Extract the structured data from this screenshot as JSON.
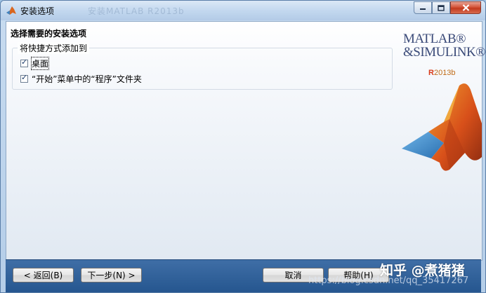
{
  "window": {
    "title": "安装选项",
    "ghost_title": "安装MATLAB R2013b"
  },
  "main": {
    "heading": "选择需要的安装选项",
    "group_label": "将快捷方式添加到",
    "options": [
      {
        "label": "桌面",
        "checked": true
      },
      {
        "label": "“开始”菜单中的“程序”文件夹",
        "checked": true
      }
    ]
  },
  "branding": {
    "product_line1": "MATLAB®",
    "product_line2": "&SIMULINK®",
    "release_prefix": "R",
    "release_suffix": "2013b"
  },
  "footer": {
    "back": "< 返回(B)",
    "next": "下一步(N) >",
    "cancel": "取消",
    "help": "帮助(H)"
  },
  "overlay": {
    "watermark": "知乎 @煮猪猪",
    "url": "https://blog.csdn.net/qq_35417267"
  },
  "colors": {
    "footer": "#2c5c96",
    "accent_orange": "#d9661f",
    "close_red": "#c8452a"
  }
}
